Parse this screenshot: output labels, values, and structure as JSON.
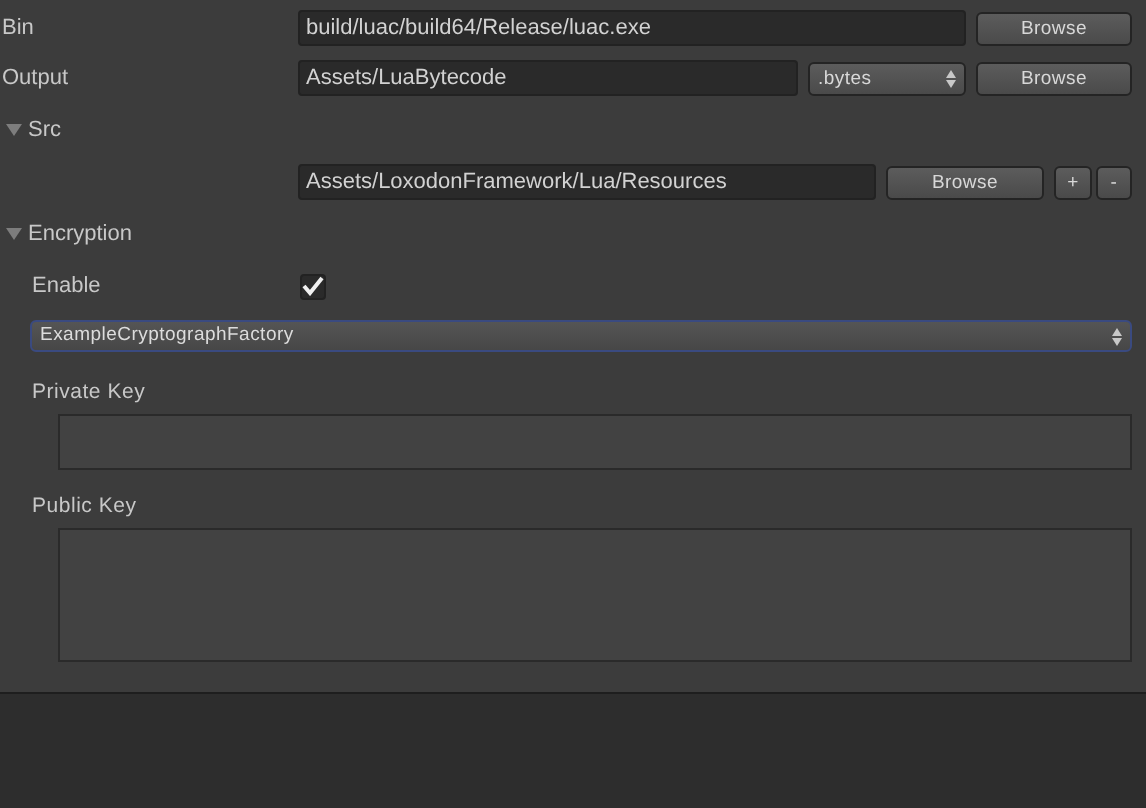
{
  "bin": {
    "label": "Bin",
    "value": "build/luac/build64/Release/luac.exe",
    "button": "Browse"
  },
  "output": {
    "label": "Output",
    "value": "Assets/LuaBytecode",
    "extension": ".bytes",
    "button": "Browse"
  },
  "src": {
    "label": "Src",
    "expanded": true,
    "paths": [
      {
        "value": "Assets/LoxodonFramework/Lua/Resources",
        "button": "Browse"
      }
    ],
    "add": "+",
    "remove": "-"
  },
  "encryption": {
    "label": "Encryption",
    "expanded": true,
    "enable": {
      "label": "Enable",
      "checked": true
    },
    "factory": "ExampleCryptographFactory",
    "private_key": {
      "label": "Private Key"
    },
    "public_key": {
      "label": "Public Key"
    }
  }
}
